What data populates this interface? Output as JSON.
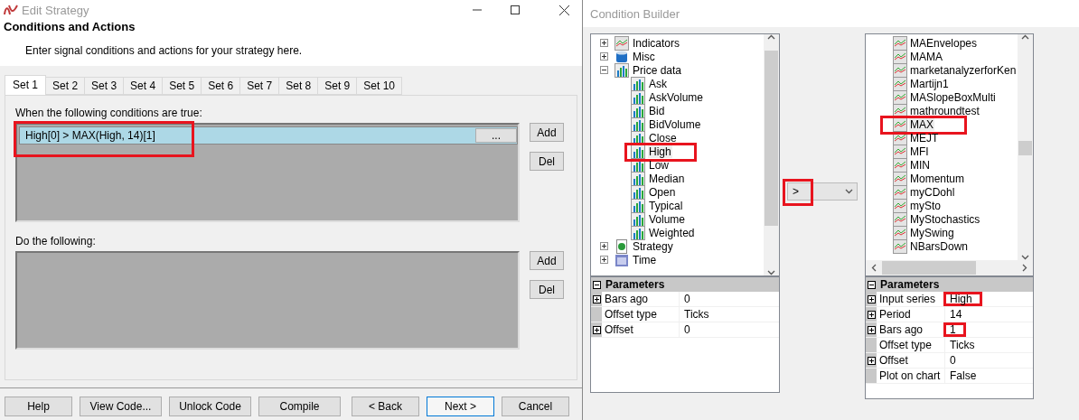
{
  "edit_strategy": {
    "title": "Edit Strategy",
    "heading": "Conditions and Actions",
    "subtitle": "Enter signal conditions and actions for your strategy here.",
    "tabs": [
      {
        "label": "Set 1",
        "selected": true
      },
      {
        "label": "Set 2",
        "selected": false
      },
      {
        "label": "Set 3",
        "selected": false
      },
      {
        "label": "Set 4",
        "selected": false
      },
      {
        "label": "Set 5",
        "selected": false
      },
      {
        "label": "Set 6",
        "selected": false
      },
      {
        "label": "Set 7",
        "selected": false
      },
      {
        "label": "Set 8",
        "selected": false
      },
      {
        "label": "Set 9",
        "selected": false
      },
      {
        "label": "Set 10",
        "selected": false
      }
    ],
    "conditions": {
      "label": "When the following conditions are true:",
      "rows": [
        {
          "text": "High[0] > MAX(High, 14)[1]",
          "button": "...",
          "selected": true,
          "highlighted": true
        }
      ],
      "buttons": [
        "Add",
        "Del"
      ]
    },
    "actions": {
      "label": "Do the following:",
      "buttons": [
        "Add",
        "Del"
      ]
    },
    "footer_buttons": [
      {
        "label": "Help",
        "default": false
      },
      {
        "label": "View Code...",
        "default": false
      },
      {
        "label": "Unlock Code",
        "default": false
      },
      {
        "label": "Compile",
        "default": false
      },
      {
        "label": "< Back",
        "default": false
      },
      {
        "label": "Next >",
        "default": true
      },
      {
        "label": "Cancel",
        "default": false
      }
    ]
  },
  "condition_builder": {
    "title": "Condition Builder",
    "left_tree": [
      {
        "label": "Indicators",
        "kind": "indicator",
        "expanded": false,
        "highlighted": false
      },
      {
        "label": "Misc",
        "kind": "misc",
        "expanded": false,
        "highlighted": false
      },
      {
        "label": "Price data",
        "kind": "price",
        "expanded": true,
        "highlighted": false,
        "children": [
          {
            "label": "Ask",
            "kind": "price",
            "highlighted": false
          },
          {
            "label": "AskVolume",
            "kind": "price",
            "highlighted": false
          },
          {
            "label": "Bid",
            "kind": "price",
            "highlighted": false
          },
          {
            "label": "BidVolume",
            "kind": "price",
            "highlighted": false
          },
          {
            "label": "Close",
            "kind": "price",
            "highlighted": false
          },
          {
            "label": "High",
            "kind": "price",
            "highlighted": true
          },
          {
            "label": "Low",
            "kind": "price",
            "highlighted": false
          },
          {
            "label": "Median",
            "kind": "price",
            "highlighted": false
          },
          {
            "label": "Open",
            "kind": "price",
            "highlighted": false
          },
          {
            "label": "Typical",
            "kind": "price",
            "highlighted": false
          },
          {
            "label": "Volume",
            "kind": "price",
            "highlighted": false
          },
          {
            "label": "Weighted",
            "kind": "price",
            "highlighted": false
          }
        ]
      },
      {
        "label": "Strategy",
        "kind": "strategy",
        "expanded": false,
        "highlighted": false
      },
      {
        "label": "Time",
        "kind": "time",
        "expanded": false,
        "highlighted": false
      }
    ],
    "left_parameters": {
      "header": "Parameters",
      "rows": [
        {
          "name": "Bars ago",
          "value": "0",
          "expandable": true,
          "highlighted": false
        },
        {
          "name": "Offset type",
          "value": "Ticks",
          "expandable": false,
          "highlighted": false
        },
        {
          "name": "Offset",
          "value": "0",
          "expandable": true,
          "highlighted": false
        }
      ]
    },
    "operator": {
      "value": ">",
      "highlighted": true
    },
    "right_tree": [
      {
        "label": "MAEnvelopes",
        "highlighted": false
      },
      {
        "label": "MAMA",
        "highlighted": false
      },
      {
        "label": "marketanalyzerforKen",
        "highlighted": false
      },
      {
        "label": "Martijn1",
        "highlighted": false
      },
      {
        "label": "MASlopeBoxMulti",
        "highlighted": false
      },
      {
        "label": "mathroundtest",
        "highlighted": false
      },
      {
        "label": "MAX",
        "highlighted": true
      },
      {
        "label": "MEJT",
        "highlighted": false
      },
      {
        "label": "MFI",
        "highlighted": false
      },
      {
        "label": "MIN",
        "highlighted": false
      },
      {
        "label": "Momentum",
        "highlighted": false
      },
      {
        "label": "myCDohl",
        "highlighted": false
      },
      {
        "label": "mySto",
        "highlighted": false
      },
      {
        "label": "MyStochastics",
        "highlighted": false
      },
      {
        "label": "MySwing",
        "highlighted": false
      },
      {
        "label": "NBarsDown",
        "highlighted": false
      }
    ],
    "right_parameters": {
      "header": "Parameters",
      "rows": [
        {
          "name": "Input series",
          "value": "High",
          "expandable": true,
          "highlighted": true
        },
        {
          "name": "Period",
          "value": "14",
          "expandable": true,
          "highlighted": false
        },
        {
          "name": "Bars ago",
          "value": "1",
          "expandable": true,
          "highlighted": true
        },
        {
          "name": "Offset type",
          "value": "Ticks",
          "expandable": false,
          "highlighted": false
        },
        {
          "name": "Offset",
          "value": "0",
          "expandable": true,
          "highlighted": false
        },
        {
          "name": "Plot on chart",
          "value": "False",
          "expandable": false,
          "highlighted": false
        }
      ]
    }
  }
}
